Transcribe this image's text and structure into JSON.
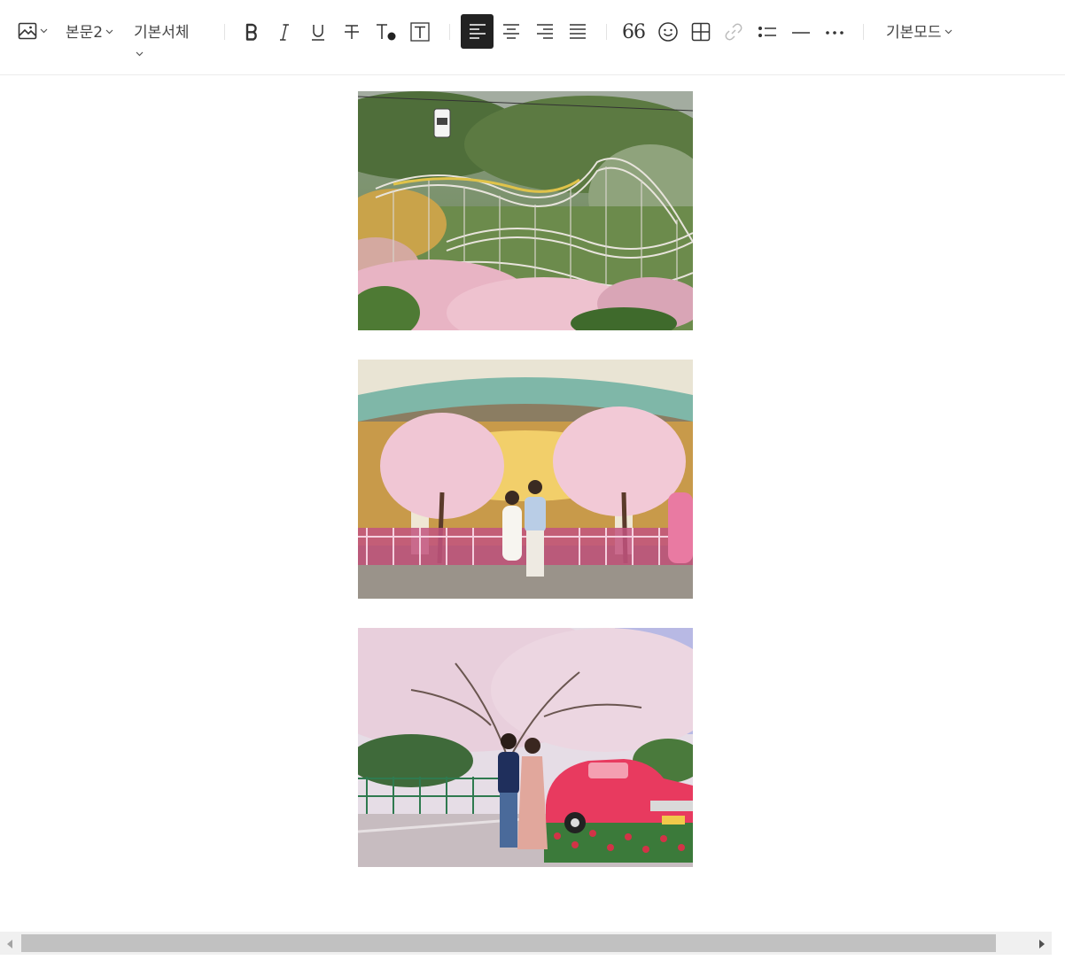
{
  "toolbar": {
    "paragraph_style": "본문2",
    "font_family": "기본서체",
    "mode": "기본모드",
    "quote_glyph": "66"
  },
  "colors": {
    "icon": "#333333",
    "active_bg": "#222222",
    "active_icon": "#ffffff",
    "link_disabled": "#bbbbbb",
    "divider": "#e3e3e3"
  },
  "icons": [
    "image-icon",
    "bold-icon",
    "italic-icon",
    "underline-icon",
    "strikethrough-icon",
    "text-color-icon",
    "text-background-icon",
    "align-left-icon",
    "align-center-icon",
    "align-right-icon",
    "align-justify-icon",
    "quote-icon",
    "emoji-icon",
    "table-icon",
    "link-icon",
    "bullet-list-icon",
    "horizontal-rule-icon",
    "more-icon"
  ],
  "editor": {
    "photos": [
      "amusement-park-rollercoaster-cherry-blossoms",
      "carousel-couple-cherry-trees",
      "couple-pink-vintage-car"
    ]
  }
}
